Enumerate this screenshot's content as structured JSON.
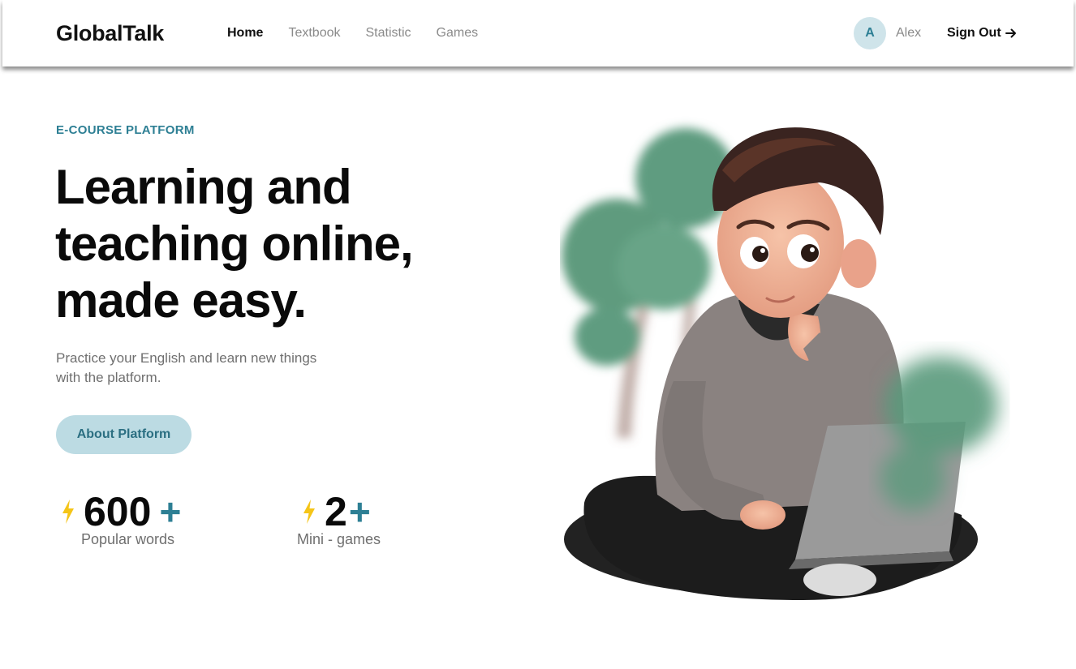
{
  "header": {
    "logo": "GlobalTalk",
    "nav": [
      {
        "label": "Home",
        "active": true
      },
      {
        "label": "Textbook",
        "active": false
      },
      {
        "label": "Statistic",
        "active": false
      },
      {
        "label": "Games",
        "active": false
      }
    ],
    "avatar_initial": "A",
    "username": "Alex",
    "signout_label": "Sign Out",
    "signout_icon": "arrow-right-icon"
  },
  "hero": {
    "eyebrow": "E-COURSE PLATFORM",
    "headline": [
      "Learning and",
      "teaching online,",
      "made easy."
    ],
    "subtitle": [
      "Practice your English and learn new things",
      "with the platform."
    ],
    "cta_label": "About Platform",
    "stats": [
      {
        "value": "600",
        "plus": "+",
        "label": "Popular words",
        "icon": "lightning-icon"
      },
      {
        "value": "2",
        "plus": "+",
        "label": "Mini - games",
        "icon": "lightning-icon"
      }
    ],
    "illustration": "boy-with-laptop-illustration"
  },
  "colors": {
    "accent": "#2d7f94",
    "button_bg": "#bcdbe3",
    "avatar_bg": "#cfe4ea",
    "bolt": "#f5c518"
  }
}
